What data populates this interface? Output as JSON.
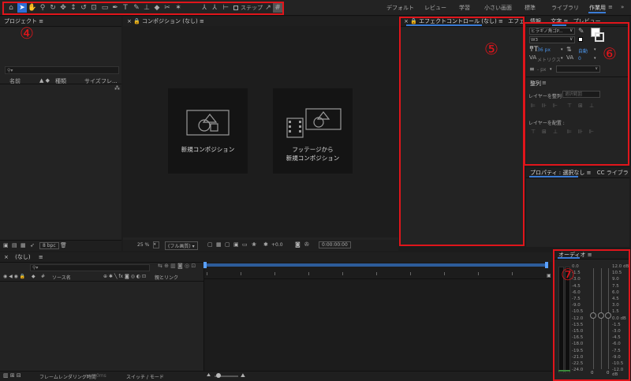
{
  "workspaces": [
    "デフォルト",
    "レビュー",
    "学習",
    "小さい画面",
    "標準",
    "ライブラリ",
    "作業用"
  ],
  "toolbar": {
    "step_label": "ステップ"
  },
  "project": {
    "title": "プロジェクト",
    "cols": [
      "名前",
      "種類",
      "サイズ",
      "フレ..."
    ],
    "bpc": "8 bpc"
  },
  "composition": {
    "title": "コンポジション (なし)",
    "new_comp": "新規コンポジション",
    "from_footage_1": "フッテージから",
    "from_footage_2": "新規コンポジション",
    "zoom": "25 %",
    "quality": "(フル画質)",
    "exposure": "+0.0",
    "timecode": "0:00:00:00"
  },
  "effects": {
    "title": "エフェクトコントロール (なし)",
    "tab2": "エフェク"
  },
  "right_tabs": [
    "情報",
    "文字",
    "プレビュー"
  ],
  "character": {
    "font": "ヒラギノ角ゴP...",
    "weight": "W3",
    "size": "36 px",
    "leading": "自動",
    "kerning": "メトリクス",
    "tracking": "0",
    "stroke": "- px"
  },
  "align": {
    "title": "整列",
    "align_to_label": "レイヤーを整列 :",
    "align_to_value": "選択範囲",
    "distribute_label": "レイヤーを配置 :"
  },
  "properties": {
    "title": "プロパティ : 選択なし",
    "libraries": "CC ライブラリ"
  },
  "timeline": {
    "title": "(なし)",
    "source_name": "ソース名",
    "parent_link": "親とリンク",
    "render_time": "フレームレンダリング時間",
    "render_value": "0ms",
    "switches": "スイッチ / モード"
  },
  "audio": {
    "title": "オーディオ",
    "left_scale": [
      "0.0",
      "-1.5",
      "-3.0",
      "-4.5",
      "-6.0",
      "-7.5",
      "-9.0",
      "-10.5",
      "-12.0",
      "-13.5",
      "-15.0",
      "-16.5",
      "-18.0",
      "-19.5",
      "-21.0",
      "-22.5",
      "-24.0"
    ],
    "right_scale": [
      "12.0 dB",
      "10.5",
      "9.0",
      "7.5",
      "6.0",
      "4.5",
      "3.0",
      "1.5",
      "0.0 dB",
      "-1.5",
      "-3.0",
      "-4.5",
      "-6.0",
      "-7.5",
      "-9.0",
      "-10.5",
      "-12.0 dB"
    ],
    "zero1": "0",
    "zero2": "0"
  },
  "annotations": [
    "④",
    "⑤",
    "⑥",
    "⑦"
  ],
  "colors": {
    "accent": "#3a7bd5",
    "annotation": "#e0151b"
  }
}
